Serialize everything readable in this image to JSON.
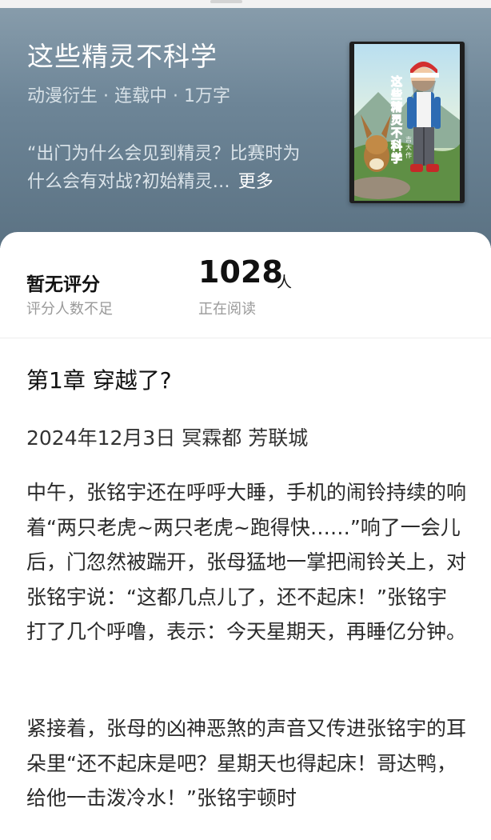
{
  "book": {
    "title": "这些精灵不科学",
    "meta": "动漫衍生 · 连载中 · 1万字",
    "description": "“出门为什么会见到精灵？比赛时为什么会有对战?初始精灵…",
    "more_label": "更多",
    "cover_title_chars": [
      "这",
      "些",
      "精",
      "灵",
      "不",
      "科",
      "学"
    ],
    "cover_author": "吉大作"
  },
  "stats": {
    "rating_label": "暂无评分",
    "rating_sub": "评分人数不足",
    "readers_count": "1028",
    "readers_unit": "人",
    "readers_sub": "正在阅读"
  },
  "chapter": {
    "title": "第1章 穿越了?",
    "date_line": "2024年12月3日 冥霖都 芳联城",
    "paragraphs": [
      "中午，张铭宇还在呼呼大睡，手机的闹铃持续的响着“两只老虎~两只老虎~跑得快……”响了一会儿后，门忽然被踹开，张母猛地一掌把闹铃关上，对张铭宇说：“这都几点儿了，还不起床！”张铭宇打了几个呼噜，表示：今天星期天，再睡亿分钟。",
      "紧接着，张母的凶神恶煞的声音又传进张铭宇的耳朵里“还不起床是吧？星期天也得起床！哥达鸭，给他一击泼冷水！”张铭宇顿时"
    ]
  },
  "colors": {
    "header_gradient_top": "#879cab",
    "header_gradient_bottom": "#5b7283",
    "text_primary": "#111111",
    "text_secondary": "#9a9a9a"
  }
}
